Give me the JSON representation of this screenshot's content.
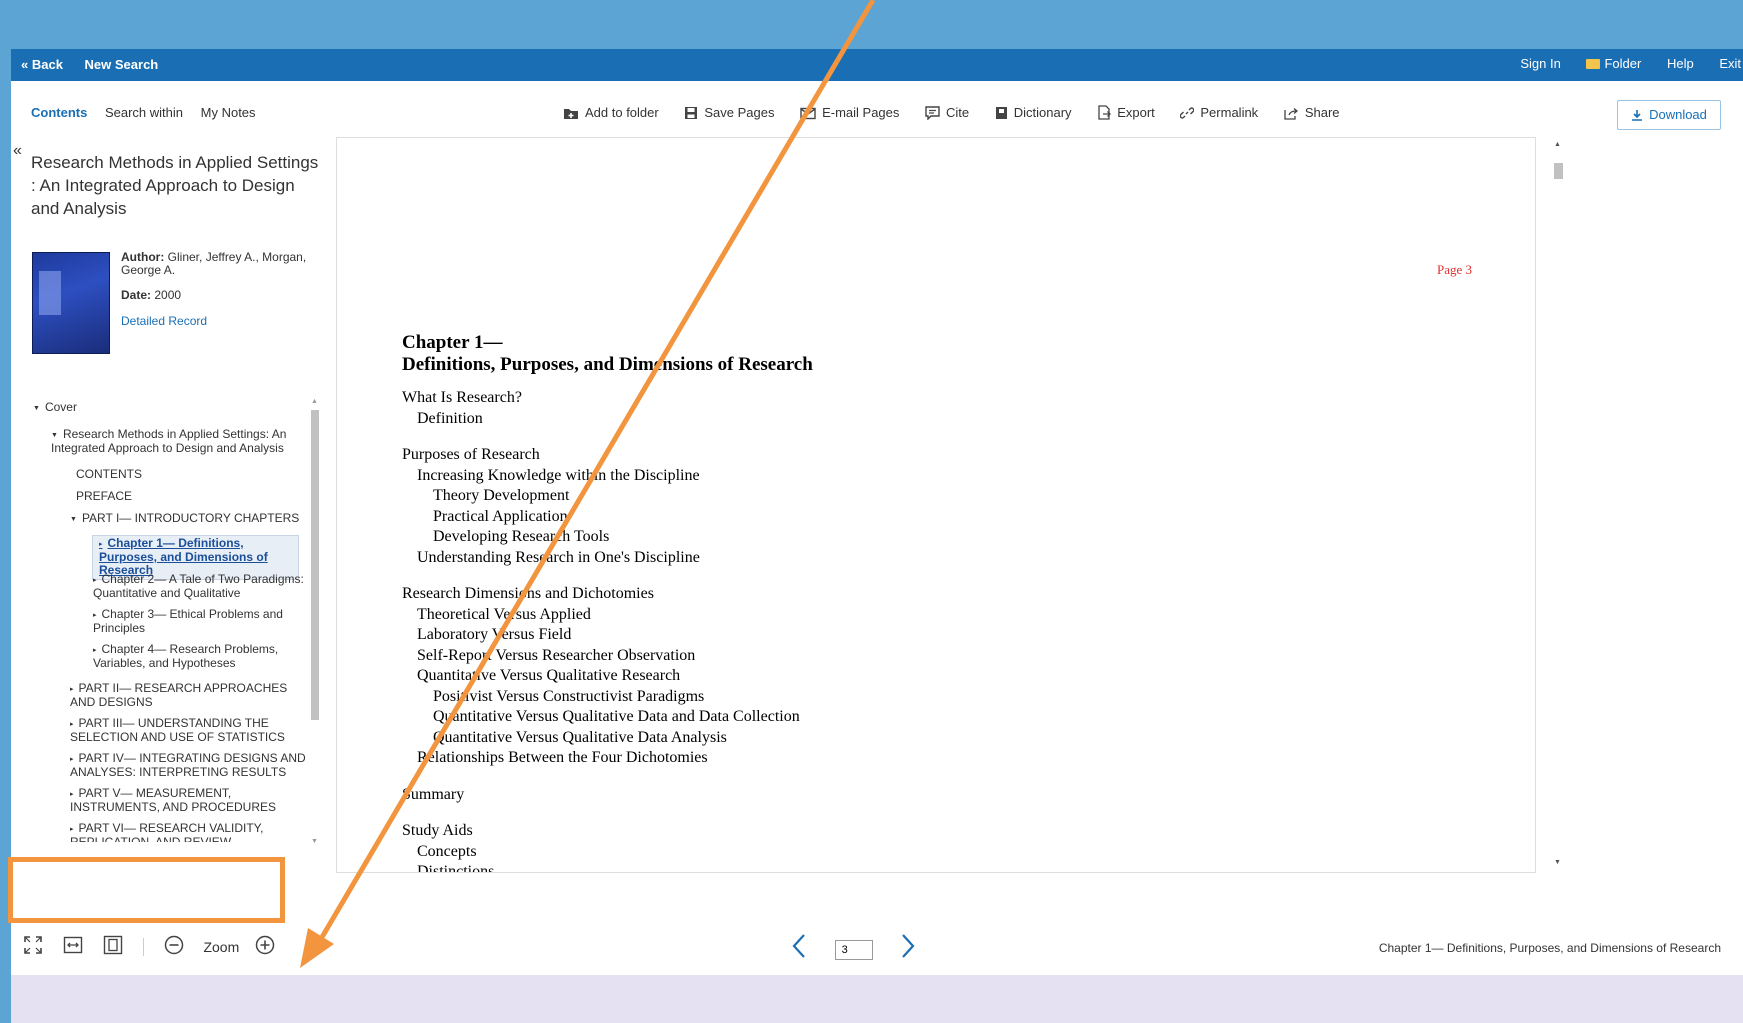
{
  "navbar": {
    "back": "« Back",
    "new_search": "New Search",
    "sign_in": "Sign In",
    "folder": "Folder",
    "help": "Help",
    "exit": "Exit"
  },
  "tabs": {
    "contents": "Contents",
    "search_within": "Search within",
    "my_notes": "My Notes"
  },
  "tools": {
    "add_to_folder": "Add to folder",
    "save_pages": "Save Pages",
    "email_pages": "E-mail Pages",
    "cite": "Cite",
    "dictionary": "Dictionary",
    "export": "Export",
    "permalink": "Permalink",
    "share": "Share",
    "download": "Download"
  },
  "sidebar": {
    "collapse": "«",
    "title": "Research Methods in Applied Settings : An Integrated Approach to Design and Analysis",
    "author_label": "Author:",
    "author": "Gliner, Jeffrey A., Morgan, George A.",
    "date_label": "Date:",
    "date": "2000",
    "detailed_record": "Detailed Record",
    "toc": [
      {
        "label": "Cover"
      },
      {
        "label": "Research Methods in Applied Settings: An Integrated Approach to Design and Analysis"
      },
      {
        "label": "CONTENTS"
      },
      {
        "label": "PREFACE"
      },
      {
        "label": "PART I— INTRODUCTORY CHAPTERS"
      },
      {
        "label": "Chapter 1— Definitions, Purposes, and Dimensions of Research"
      },
      {
        "label": "Chapter 2— A Tale of Two Paradigms: Quantitative and Qualitative"
      },
      {
        "label": "Chapter 3— Ethical Problems and Principles"
      },
      {
        "label": "Chapter 4— Research Problems, Variables, and Hypotheses"
      },
      {
        "label": "PART II— RESEARCH APPROACHES AND DESIGNS"
      },
      {
        "label": "PART III— UNDERSTANDING THE SELECTION AND USE OF STATISTICS"
      },
      {
        "label": "PART IV— INTEGRATING DESIGNS AND ANALYSES: INTERPRETING RESULTS"
      },
      {
        "label": "PART V— MEASUREMENT, INSTRUMENTS, AND PROCEDURES"
      },
      {
        "label": "PART VI— RESEARCH VALIDITY, REPLICATION, AND REVIEW"
      }
    ]
  },
  "document": {
    "page_label": "Page 3",
    "chapter_line1": "Chapter 1—",
    "chapter_line2": "Definitions, Purposes, and Dimensions of Research",
    "lines": [
      "What Is Research?",
      "Definition",
      "Purposes of Research",
      "Increasing Knowledge within the Discipline",
      "Theory Development",
      "Practical Application",
      "Developing Research Tools",
      "Understanding Research in One's Discipline",
      "Research Dimensions and Dichotomies",
      "Theoretical Versus Applied",
      "Laboratory Versus Field",
      "Self-Report Versus Researcher Observation",
      "Quantitative Versus Qualitative Research",
      "Positivist Versus Constructivist Paradigms",
      "Quantitative Versus Qualitative Data and Data Collection",
      "Quantitative Versus Qualitative Data Analysis",
      "Relationships Between the Four Dichotomies",
      "Summary",
      "Study Aids",
      "Concepts",
      "Distinctions"
    ]
  },
  "bottom": {
    "zoom_label": "Zoom",
    "page_input": "3",
    "footer_chapter": "Chapter 1— Definitions, Purposes, and Dimensions of Research"
  },
  "colors": {
    "nav": "#1a6fb4",
    "annotation": "#f2953e",
    "page_number": "#e03030"
  }
}
